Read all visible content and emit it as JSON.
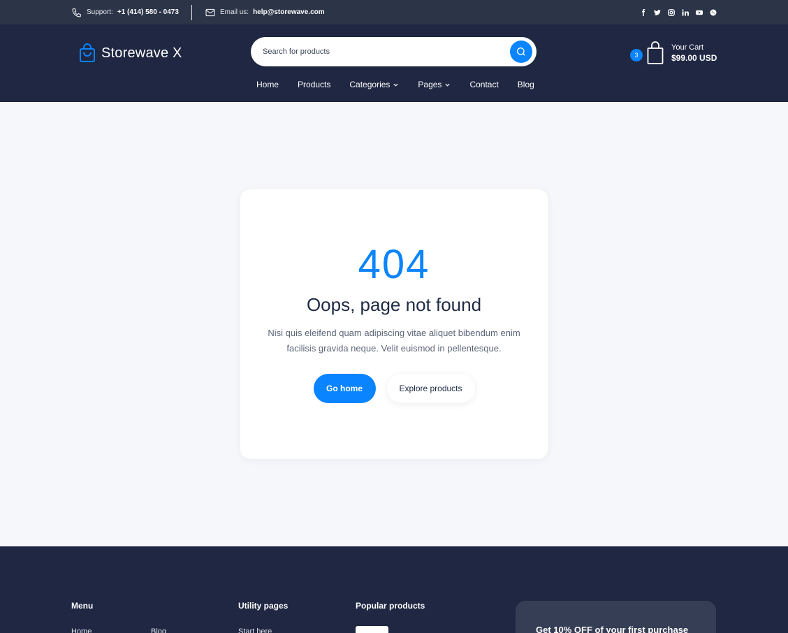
{
  "topbar": {
    "support_label": "Support:",
    "support_value": "+1 (414) 580 - 0473",
    "email_label": "Email us:",
    "email_value": "help@storewave.com",
    "social": [
      "f",
      "t",
      "ig",
      "in",
      "yt",
      "wa"
    ]
  },
  "header": {
    "logo_text": "Storewave X",
    "search_placeholder": "Search for products",
    "cart": {
      "count": "3",
      "label": "Your Cart",
      "total": "$99.00 USD"
    },
    "nav": [
      "Home",
      "Products",
      "Categories",
      "Pages",
      "Contact",
      "Blog"
    ]
  },
  "error": {
    "code": "404",
    "title": "Oops, page not found",
    "description": "Nisi quis eleifend quam adipiscing vitae aliquet bibendum enim facilisis gravida neque. Velit euismod in pellentesque.",
    "primary_button": "Go home",
    "secondary_button": "Explore products"
  },
  "footer": {
    "menu_title": "Menu",
    "menu_items": [
      "Home",
      "Blog"
    ],
    "utility_title": "Utility pages",
    "utility_items": [
      "Start here"
    ],
    "popular_title": "Popular products",
    "promo_text": "Get 10% OFF of your first purchase"
  },
  "colors": {
    "accent": "#0a84ff",
    "navy": "#1f2742",
    "topbar": "#2c3448"
  }
}
